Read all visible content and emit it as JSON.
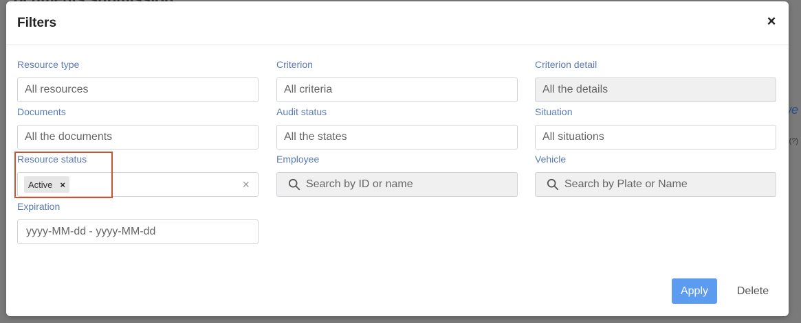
{
  "background": {
    "title_fragment": "ocuments submission",
    "right_fragment": "we",
    "help_fragment": "(?)"
  },
  "modal": {
    "title": "Filters",
    "close_icon": "close-icon"
  },
  "fields": {
    "resource_type": {
      "label": "Resource type",
      "placeholder": "All resources"
    },
    "criterion": {
      "label": "Criterion",
      "placeholder": "All criteria"
    },
    "criterion_detail": {
      "label": "Criterion detail",
      "placeholder": "All the details"
    },
    "documents": {
      "label": "Documents",
      "placeholder": "All the documents"
    },
    "audit_status": {
      "label": "Audit status",
      "placeholder": "All the states"
    },
    "situation": {
      "label": "Situation",
      "placeholder": "All situations"
    },
    "resource_status": {
      "label": "Resource status",
      "selected_tag": "Active",
      "tag_remove": "×",
      "clear": "×"
    },
    "employee": {
      "label": "Employee",
      "placeholder": "Search by ID or name",
      "icon": "search-icon"
    },
    "vehicle": {
      "label": "Vehicle",
      "placeholder": "Search by Plate or Name",
      "icon": "search-icon"
    },
    "expiration": {
      "label": "Expiration",
      "placeholder": "yyyy-MM-dd - yyyy-MM-dd"
    }
  },
  "actions": {
    "apply": "Apply",
    "delete": "Delete"
  },
  "colors": {
    "accent": "#5b9bf0",
    "label": "#5b7ab5",
    "highlight": "#c8532f"
  }
}
